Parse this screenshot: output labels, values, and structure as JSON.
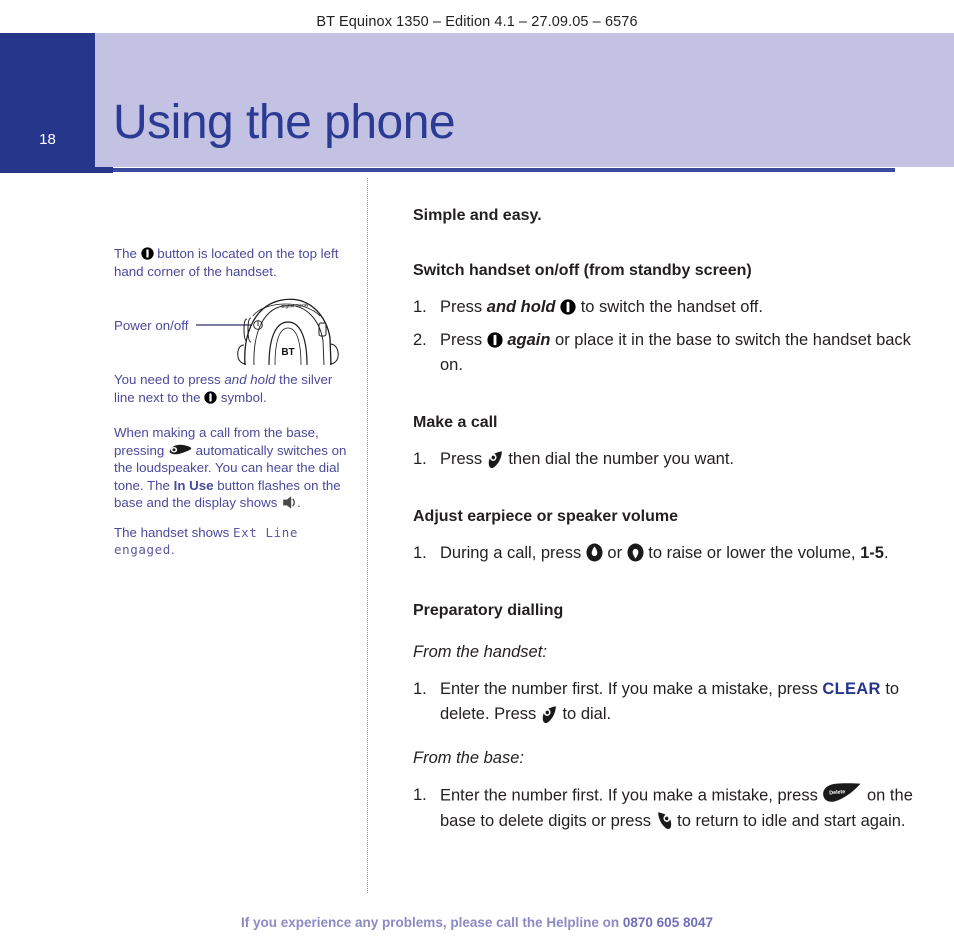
{
  "running_head": "BT Equinox 1350 – Edition 4.1 – 27.09.05 – 6576",
  "page": {
    "number": "18",
    "chapter_title": "Using the phone",
    "tab_color": "#26368a",
    "band_color": "#c3c2e2",
    "title_color": "#2b3a93"
  },
  "sidebar": {
    "note1_a": "The ",
    "note1_b": " button is located on the top left hand corner of the handset.",
    "figure_label": "Power on/off",
    "figure_brand": "BT",
    "figure_caption": "Digital Clarity",
    "note2_a": "You need to press ",
    "note2_b": "and hold",
    "note2_c": " the silver line next to the ",
    "note2_d": " symbol.",
    "note3_a": "When making a call from the base, pressing ",
    "note3_b": " automatically switches on the loudspeaker. You can hear the dial tone. The ",
    "note3_c": "In Use",
    "note3_d": " button flashes on the base and the display shows ",
    "note3_e": ".",
    "note4_a": "The handset shows ",
    "note4_lcd": "Ext Line engaged",
    "note4_b": "."
  },
  "main": {
    "intro": "Simple and easy.",
    "sections": [
      {
        "heading": "Switch handset on/off (from standby screen)",
        "steps": [
          {
            "num": "1.",
            "parts": [
              "Press ",
              "and hold",
              " ",
              "power-icon",
              " to switch the handset off."
            ]
          },
          {
            "num": "2.",
            "parts": [
              "Press ",
              "power-icon",
              " ",
              "again",
              " or place it in the base to switch the handset back on."
            ]
          }
        ]
      },
      {
        "heading": "Make a call",
        "steps": [
          {
            "num": "1.",
            "parts": [
              "Press ",
              "dial-icon",
              " then dial the number you want."
            ]
          }
        ]
      },
      {
        "heading": "Adjust earpiece or speaker volume",
        "steps": [
          {
            "num": "1.",
            "parts": [
              "During a call, press ",
              "volume-up-icon",
              " or ",
              "volume-down-icon",
              " to raise or lower the volume, ",
              "1-5",
              "."
            ]
          }
        ]
      },
      {
        "heading": "Preparatory dialling",
        "sub1": "From the handset:",
        "sub2": "From the base:",
        "steps": [
          {
            "num": "1.",
            "parts": [
              "Enter the number first. If you make a mistake, press ",
              "CLEAR",
              " to delete. Press ",
              "dial-icon",
              " to dial."
            ]
          },
          {
            "num": "1.",
            "parts": [
              "Enter the number first. If you make a mistake, press ",
              "delete-key-icon",
              " on the base to delete digits or press ",
              "end-call-icon",
              " to return to idle and start again."
            ]
          }
        ]
      }
    ],
    "text": {
      "intro": "Simple and easy.",
      "h1": "Switch handset on/off (from standby screen)",
      "s1_1a": "Press ",
      "s1_1b": "and hold",
      "s1_1c": " to switch the handset off.",
      "s1_2a": "Press ",
      "s1_2b": "again",
      "s1_2c": " or place it in the base to switch the handset back on.",
      "h2": "Make a call",
      "s2_1a": "Press ",
      "s2_1b": " then dial the number you want.",
      "h3": "Adjust earpiece or speaker volume",
      "s3_1a": "During a call, press ",
      "s3_1b": " or ",
      "s3_1c": " to raise or lower the volume, ",
      "s3_1d": "1-5",
      "s3_1e": ".",
      "h4": "Preparatory dialling",
      "sub_handset": "From the handset:",
      "sub_base": "From the base:",
      "s4_1a": "Enter the number first. If you make a mistake, press ",
      "s4_1b": "CLEAR",
      "s4_1c": " to delete. Press ",
      "s4_1d": " to dial.",
      "s4_2a": "Enter the number first. If you make a mistake, press ",
      "s4_2b": " on the base to delete digits or press ",
      "s4_2c": " to return to idle and start again.",
      "num1": "1.",
      "num2": "2.",
      "num3": "1.",
      "num4": "1.",
      "num5": "1.",
      "num6": "1."
    }
  },
  "footer": {
    "text": "If you experience any problems, please call the Helpline on ",
    "phone": "0870 605 8047"
  },
  "icons": {
    "power": "power-icon",
    "dial": "dial-icon",
    "volume_up": "volume-up-icon",
    "volume_down": "volume-down-icon",
    "loudspeaker": "loudspeaker-icon",
    "speaker_display": "speaker-display-icon",
    "delete_key": "delete-key-icon",
    "end_call": "end-call-icon",
    "delete_key_label": "Delete"
  }
}
